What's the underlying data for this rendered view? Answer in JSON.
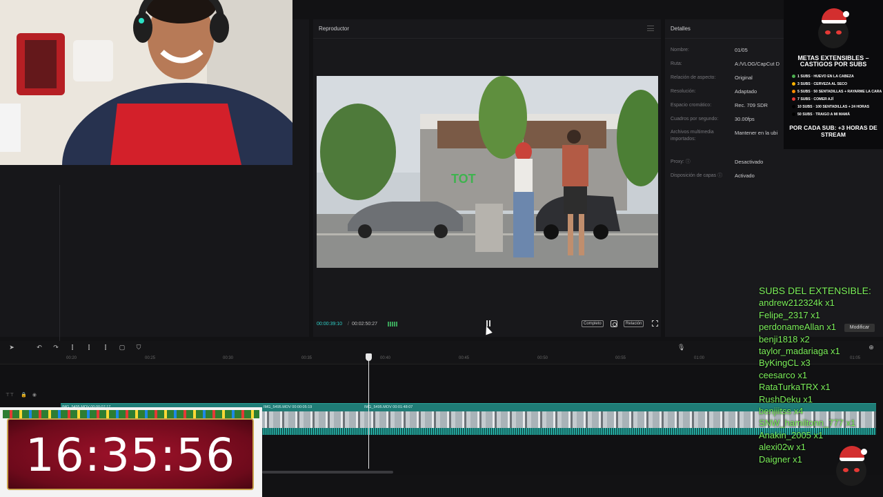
{
  "player": {
    "title": "Reproductor",
    "time_current": "00:00:39:10",
    "time_sep": "/",
    "time_total": "00:02:50:27",
    "btn_full": "Completo",
    "btn_ratio": "Relación"
  },
  "details": {
    "title": "Detalles",
    "rows": [
      {
        "label": "Nombre:",
        "value": "01/05"
      },
      {
        "label": "Ruta:",
        "value": "A:/VLOG/CapCut D"
      },
      {
        "label": "Relación de aspecto:",
        "value": "Original"
      },
      {
        "label": "Resolución:",
        "value": "Adaptado"
      },
      {
        "label": "Espacio cromático:",
        "value": "Rec. 709 SDR"
      },
      {
        "label": "Cuadros por segundo:",
        "value": "30.00fps"
      },
      {
        "label": "Archivos multimedia importados:",
        "value": "Mantener en la ubi"
      },
      {
        "label": "Proxy: ⓘ",
        "value": "Desactivado"
      },
      {
        "label": "Disposición de capas ⓘ",
        "value": "Activado"
      }
    ]
  },
  "timeline": {
    "ticks": [
      "00:20",
      "00:25",
      "00:30",
      "00:35",
      "00:40",
      "00:45",
      "00:50",
      "00:55",
      "01:00",
      "01:05"
    ],
    "clips": [
      "IMG_5495.MOV  00:00:07:17",
      "IMG_5495.MOV  00:00:05:19",
      "IMG_5495.MOV  00:01:48:07"
    ]
  },
  "metas": {
    "title": "METAS EXTENSIBLES – CASTIGOS POR SUBS",
    "rows": [
      {
        "subs": "1 SUBS",
        "text": "HUEVO EN LA CABEZA",
        "color": "#4caf50"
      },
      {
        "subs": "3 SUBS",
        "text": "CERVEZA AL SECO",
        "color": "#ffb300"
      },
      {
        "subs": "5 SUBS",
        "text": "50 SENTADILLAS + RAYARME LA CARA",
        "color": "#fb8c00"
      },
      {
        "subs": "7 SUBS",
        "text": "COMER AJÍ",
        "color": "#e53935"
      },
      {
        "subs": "10 SUBS",
        "text": "100 SENTADILLAS + 24 HORAS",
        "color": "#000000"
      },
      {
        "subs": "50 SUBS",
        "text": "TRAIGO A MI MAMÁ",
        "color": "#000000"
      }
    ],
    "footer": "POR CADA SUB: +3 HORAS DE STREAM"
  },
  "subs": {
    "title": "SUBS DEL EXTENSIBLE:",
    "list": [
      "andrew212324k x1",
      "Felipe_2317 x1",
      "perdonameAllan x1",
      "benji1818 x2",
      "taylor_madariaga x1",
      "ByKingCL x3",
      "ceesarco x1",
      "RataTurkaTRX x1",
      "RushDeku x1",
      "benjiitss x4",
      "SNW_hamiltonn_777 x1",
      "Anakin_2005 x1",
      "alexi02w x1",
      "Daigner x1"
    ],
    "modificar": "Modificar"
  },
  "clock": {
    "time": "16:35:56"
  }
}
